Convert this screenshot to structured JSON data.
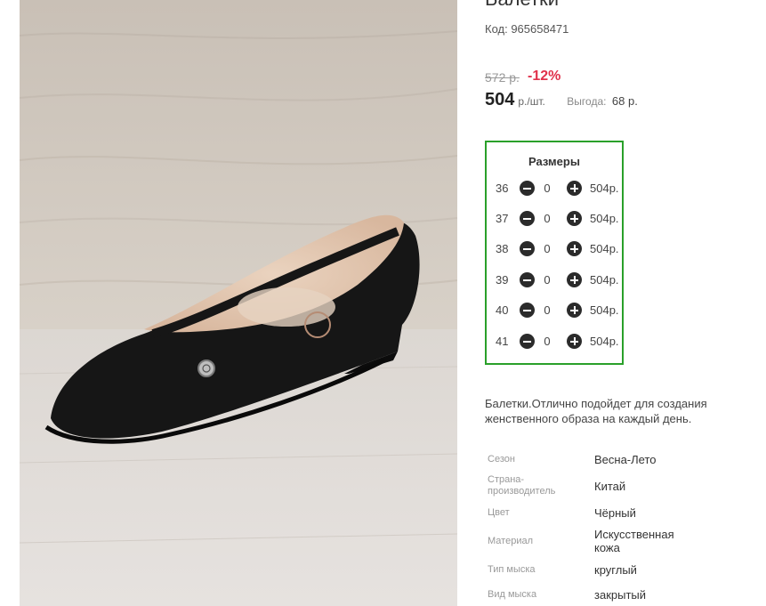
{
  "product": {
    "title": "Балетки",
    "code_text": "Код: 965658471",
    "old_price": "572 р.",
    "discount": "-12%",
    "price": "504",
    "price_unit": "р./шт.",
    "savings_label": "Выгода:",
    "savings_value": "68 р."
  },
  "sizes": {
    "title": "Размеры",
    "rows": [
      {
        "size": "36",
        "qty": "0",
        "price": "504р."
      },
      {
        "size": "37",
        "qty": "0",
        "price": "504р."
      },
      {
        "size": "38",
        "qty": "0",
        "price": "504р."
      },
      {
        "size": "39",
        "qty": "0",
        "price": "504р."
      },
      {
        "size": "40",
        "qty": "0",
        "price": "504р."
      },
      {
        "size": "41",
        "qty": "0",
        "price": "504р."
      }
    ]
  },
  "description": "Балетки.Отлично подойдет для создания женственного образа на каждый день.",
  "specs": [
    {
      "label": "Сезон",
      "value": "Весна-Лето"
    },
    {
      "label": "Страна-производитель",
      "value": "Китай"
    },
    {
      "label": "Цвет",
      "value": "Чёрный"
    },
    {
      "label": "Материал",
      "value": "Искусственная кожа"
    },
    {
      "label": "Тип мыска",
      "value": "круглый"
    },
    {
      "label": "Вид мыска",
      "value": "закрытый"
    }
  ],
  "colors": {
    "discount": "#e0314b",
    "sizes_border": "#2aa02a",
    "button": "#2b2b2b"
  }
}
